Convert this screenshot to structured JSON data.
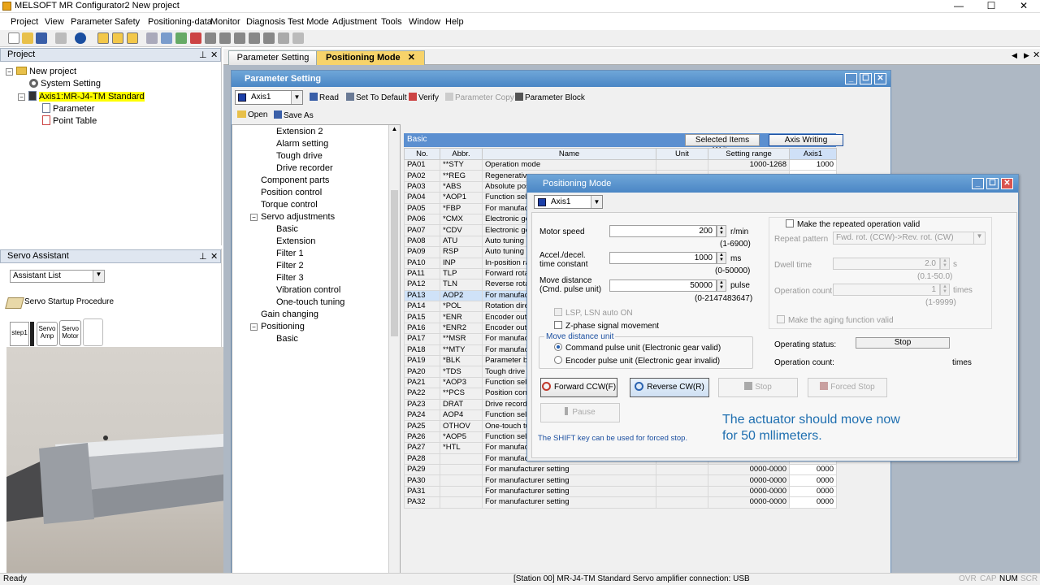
{
  "app": {
    "title": "MELSOFT MR Configurator2 New project",
    "min": "—",
    "max": "☐",
    "close": "✕"
  },
  "menu": [
    "Project",
    "View",
    "Parameter",
    "Safety",
    "Positioning-data",
    "Monitor",
    "Diagnosis",
    "Test Mode",
    "Adjustment",
    "Tools",
    "Window",
    "Help"
  ],
  "project_panel": {
    "title": "Project",
    "pin": "⊥",
    "close": "✕",
    "items": [
      "New project",
      "System Setting",
      "Axis1:MR-J4-TM Standard",
      "Parameter",
      "Point Table"
    ]
  },
  "servo_assistant": {
    "title": "Servo Assistant",
    "list_value": "Assistant List",
    "procedure": "Servo Startup Procedure",
    "step_label": "step1",
    "card1": "Servo Amp",
    "card2": "Servo Motor"
  },
  "tabs": [
    "Parameter Setting",
    "Positioning Mode"
  ],
  "tab_close": "✕",
  "param_window": {
    "title": "Parameter Setting",
    "axis": "Axis1",
    "toolbar": [
      "Read",
      "Set To Default",
      "Verify",
      "Parameter Copy",
      "Parameter Block"
    ],
    "toolbar2": [
      "Open",
      "Save As"
    ],
    "tree": [
      "Extension 2",
      "Alarm setting",
      "Tough drive",
      "Drive recorder",
      "Component parts",
      "Position control",
      "Torque control",
      "Servo adjustments",
      "Basic",
      "Extension",
      "Filter 1",
      "Filter 2",
      "Filter 3",
      "Vibration control",
      "One-touch tuning",
      "Gain changing",
      "Positioning",
      "Basic"
    ],
    "grid_title": "Basic",
    "btn_selected_write": "Selected Items Write",
    "btn_axis_write": "Axis Writing",
    "headers": [
      "No.",
      "Abbr.",
      "Name",
      "Unit",
      "Setting range",
      "Axis1"
    ],
    "rows": [
      [
        "PA01",
        "**STY",
        "Operation mode",
        "",
        "1000-1268",
        "1000"
      ],
      [
        "PA02",
        "**REG",
        "Regenerative",
        "",
        "",
        ""
      ],
      [
        "PA03",
        "*ABS",
        "Absolute pos",
        "",
        "",
        ""
      ],
      [
        "PA04",
        "*AOP1",
        "Function sele",
        "",
        "",
        ""
      ],
      [
        "PA05",
        "*FBP",
        "For manufact",
        "",
        "",
        ""
      ],
      [
        "PA06",
        "*CMX",
        "Electronic ge",
        "",
        "",
        ""
      ],
      [
        "PA07",
        "*CDV",
        "Electronic ge",
        "",
        "",
        ""
      ],
      [
        "PA08",
        "ATU",
        "Auto tuning m",
        "",
        "",
        ""
      ],
      [
        "PA09",
        "RSP",
        "Auto tuning re",
        "",
        "",
        ""
      ],
      [
        "PA10",
        "INP",
        "In-position ra",
        "",
        "",
        ""
      ],
      [
        "PA11",
        "TLP",
        "Forward rotat",
        "",
        "",
        ""
      ],
      [
        "PA12",
        "TLN",
        "Reverse rotat",
        "",
        "",
        ""
      ],
      [
        "PA13",
        "AOP2",
        "For manufact",
        "",
        "",
        ""
      ],
      [
        "PA14",
        "*POL",
        "Rotation dire",
        "",
        "",
        ""
      ],
      [
        "PA15",
        "*ENR",
        "Encoder outp",
        "",
        "",
        ""
      ],
      [
        "PA16",
        "*ENR2",
        "Encoder outp",
        "",
        "",
        ""
      ],
      [
        "PA17",
        "**MSR",
        "For manufact",
        "",
        "",
        ""
      ],
      [
        "PA18",
        "**MTY",
        "For manufact",
        "",
        "",
        ""
      ],
      [
        "PA19",
        "*BLK",
        "Parameter blo",
        "",
        "",
        ""
      ],
      [
        "PA20",
        "*TDS",
        "Tough drive s",
        "",
        "",
        ""
      ],
      [
        "PA21",
        "*AOP3",
        "Function sele",
        "",
        "",
        ""
      ],
      [
        "PA22",
        "**PCS",
        "Position contr",
        "",
        "",
        ""
      ],
      [
        "PA23",
        "DRAT",
        "Drive recorde",
        "",
        "",
        ""
      ],
      [
        "PA24",
        "AOP4",
        "Function sele",
        "",
        "",
        ""
      ],
      [
        "PA25",
        "OTHOV",
        "One-touch tu",
        "",
        "",
        ""
      ],
      [
        "PA26",
        "*AOP5",
        "Function sele",
        "",
        "",
        ""
      ],
      [
        "PA27",
        "*HTL",
        "For manufact",
        "",
        "",
        ""
      ],
      [
        "PA28",
        "",
        "For manufact",
        "",
        "",
        ""
      ],
      [
        "PA29",
        "",
        "For manufacturer setting",
        "",
        "0000-0000",
        "0000"
      ],
      [
        "PA30",
        "",
        "For manufacturer setting",
        "",
        "0000-0000",
        "0000"
      ],
      [
        "PA31",
        "",
        "For manufacturer setting",
        "",
        "0000-0000",
        "0000"
      ],
      [
        "PA32",
        "",
        "For manufacturer setting",
        "",
        "0000-0000",
        "0000"
      ]
    ]
  },
  "pos_dialog": {
    "title": "Positioning Mode",
    "axis": "Axis1",
    "motor_speed_label": "Motor speed",
    "motor_speed_value": "200",
    "motor_speed_unit": "r/min",
    "motor_speed_range": "(1-6900)",
    "accel_label1": "Accel./decel.",
    "accel_label2": "time constant",
    "accel_value": "1000",
    "accel_unit": "ms",
    "accel_range": "(0-50000)",
    "move_label1": "Move distance",
    "move_label2": "(Cmd. pulse unit)",
    "move_value": "50000",
    "move_unit": "pulse",
    "move_range": "(0-2147483647)",
    "lsp": "LSP, LSN auto ON",
    "zphase": "Z-phase signal movement",
    "unit_group": "Move distance unit",
    "radio1": "Command pulse unit (Electronic gear valid)",
    "radio2": "Encoder pulse unit (Electronic gear invalid)",
    "repeat_cb": "Make the repeated operation valid",
    "repeat_pattern_label": "Repeat pattern",
    "repeat_pattern_value": "Fwd. rot. (CCW)->Rev. rot. (CW)",
    "dwell_label": "Dwell time",
    "dwell_value": "2.0",
    "dwell_unit": "s",
    "dwell_range": "(0.1-50.0)",
    "opcount_label": "Operation count",
    "opcount_value": "1",
    "opcount_unit": "times",
    "opcount_range": "(1-9999)",
    "aging_cb": "Make the aging function valid",
    "op_status_label": "Operating status:",
    "op_status_value": "Stop",
    "op_count_label": "Operation count:",
    "op_count_unit": "times",
    "btn_forward": "Forward CCW(F)",
    "btn_reverse": "Reverse CW(R)",
    "btn_stop": "Stop",
    "btn_forced": "Forced Stop",
    "btn_pause": "Pause",
    "shift_note": "The SHIFT key can be used for forced stop.",
    "caption1": "The actuator should move now",
    "caption2": "for 50 mllimeters."
  },
  "status": {
    "left": "Ready",
    "connection": "[Station 00] MR-J4-TM Standard Servo amplifier connection: USB",
    "ovr": "OVR",
    "cap": "CAP",
    "num": "NUM",
    "scr": "SCR"
  }
}
